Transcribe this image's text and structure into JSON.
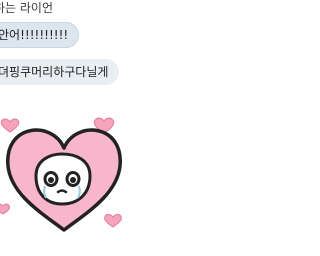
{
  "conversation": {
    "sender_name": "하는 라이언",
    "messages": [
      {
        "text": "안어!!!!!!!!!!"
      },
      {
        "text": "뎌핑쿠머리하구다닐게"
      }
    ],
    "sticker": {
      "icon": "pink-heart-character-sticker",
      "colors": {
        "heart": "#f8b6cc",
        "outline": "#222222",
        "face": "#ffffff",
        "small_hearts": "#f6a4bd"
      }
    }
  }
}
